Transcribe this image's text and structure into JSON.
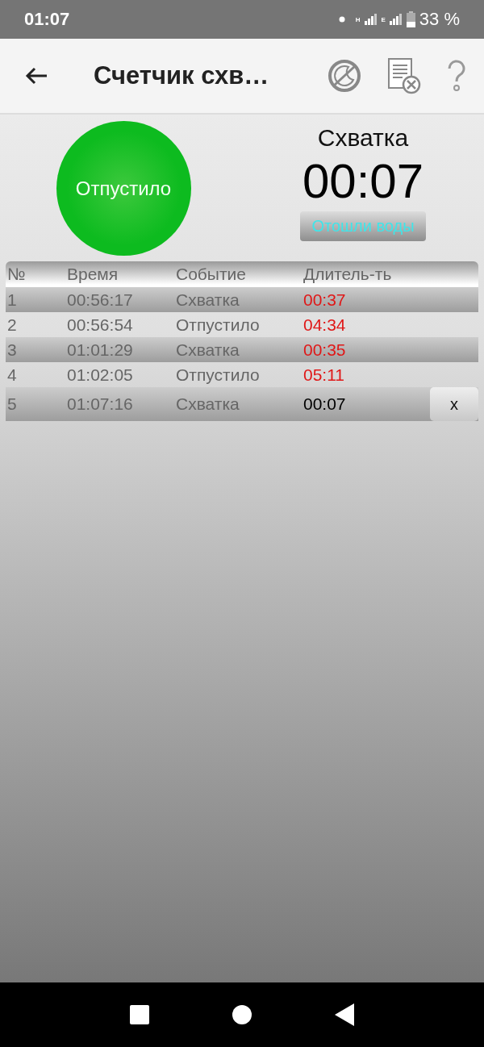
{
  "status_bar": {
    "time": "01:07",
    "network_labels": [
      "H",
      "E"
    ],
    "battery": "33 %"
  },
  "app_bar": {
    "title": "Счетчик схв…"
  },
  "timer": {
    "button_label": "Отпустило",
    "phase": "Схватка",
    "elapsed": "00:07",
    "water_button": "Отошли воды"
  },
  "table": {
    "columns": [
      "№",
      "Время",
      "Событие",
      "Длитель-ть"
    ],
    "rows": [
      {
        "number": "1",
        "time": "00:56:17",
        "event": "Схватка",
        "duration": "00:37",
        "current": false
      },
      {
        "number": "2",
        "time": "00:56:54",
        "event": "Отпустило",
        "duration": "04:34",
        "current": false
      },
      {
        "number": "3",
        "time": "01:01:29",
        "event": "Схватка",
        "duration": "00:35",
        "current": false
      },
      {
        "number": "4",
        "time": "01:02:05",
        "event": "Отпустило",
        "duration": "05:11",
        "current": false
      },
      {
        "number": "5",
        "time": "01:07:16",
        "event": "Схватка",
        "duration": "00:07",
        "current": true,
        "delete_label": "x"
      }
    ]
  }
}
